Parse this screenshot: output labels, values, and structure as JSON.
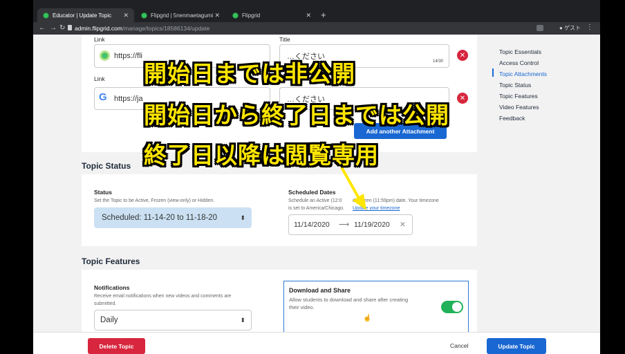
{
  "browser": {
    "tabs": [
      {
        "title": "Educator | Update Topic"
      },
      {
        "title": "Flipgrid | 5nenmaetagumi"
      },
      {
        "title": "Flipgrid"
      }
    ],
    "url_host": "admin.flipgrid.com",
    "url_path": "/manage/topics/18586134/update",
    "profile_label": "ゲスト"
  },
  "attachments": {
    "link_label": "Link",
    "title_label": "Title",
    "rows": [
      {
        "link": "https://fli",
        "title_text": "…ください",
        "counter": "14/30"
      },
      {
        "link": "https://ja",
        "title_text": "…ください",
        "counter": ""
      }
    ],
    "add_button": "Add another Attachment"
  },
  "topic_status": {
    "section_title": "Topic Status",
    "status_label": "Status",
    "status_help": "Set the Topic to be Active, Frozen (view-only) or Hidden.",
    "status_value": "Scheduled: 11-14-20 to 11-18-20",
    "dates_label": "Scheduled Dates",
    "dates_help_1": "Schedule an Active (12:0",
    "dates_help_2": "d Frozen (11:59pm) date. Your timezone",
    "dates_help_3": "is set to America/Chicago.",
    "timezone_link": "Update your timezone",
    "start_date": "11/14/2020",
    "end_date": "11/19/2020"
  },
  "topic_features": {
    "section_title": "Topic Features",
    "notifications_label": "Notifications",
    "notifications_help": "Receive email notifications when new videos and comments are submitted.",
    "notifications_value": "Daily",
    "download_title": "Download and Share",
    "download_help": "Allow students to download and share after creating their video.",
    "download_enabled": true
  },
  "sidebar": {
    "items": [
      {
        "label": "Topic Essentials"
      },
      {
        "label": "Access Control"
      },
      {
        "label": "Topic Attachments"
      },
      {
        "label": "Topic Status"
      },
      {
        "label": "Topic Features"
      },
      {
        "label": "Video Features"
      },
      {
        "label": "Feedback"
      }
    ]
  },
  "footer": {
    "delete": "Delete Topic",
    "cancel": "Cancel",
    "update": "Update Topic"
  },
  "captions": {
    "line1": "開始日までは非公開",
    "line2": "開始日から終了日までは公開",
    "line3": "終了日以降は閲覧専用"
  },
  "colors": {
    "accent": "#1967d2",
    "danger": "#d7263d",
    "toggle_on": "#21b259",
    "caption": "#ffe600"
  }
}
